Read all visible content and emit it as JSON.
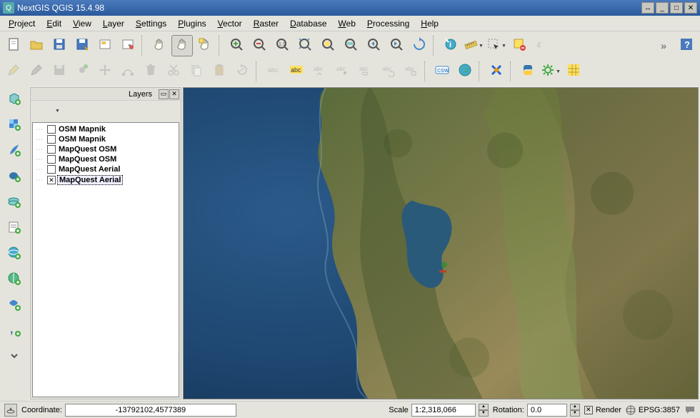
{
  "window": {
    "title": "NextGIS QGIS 15.4.98"
  },
  "menu": {
    "items": [
      "Project",
      "Edit",
      "View",
      "Layer",
      "Settings",
      "Plugins",
      "Vector",
      "Raster",
      "Database",
      "Web",
      "Processing",
      "Help"
    ]
  },
  "toolbar1": [
    {
      "name": "new-project",
      "icon": "doc"
    },
    {
      "name": "open-project",
      "icon": "folder"
    },
    {
      "name": "save-project",
      "icon": "save"
    },
    {
      "name": "save-as",
      "icon": "save-as"
    },
    {
      "name": "print-composer",
      "icon": "composer"
    },
    {
      "name": "composer-manager",
      "icon": "composer-mgr"
    },
    {
      "sep": true
    },
    {
      "name": "pan",
      "icon": "hand",
      "active": false
    },
    {
      "name": "pan-selection",
      "icon": "hand",
      "active": true
    },
    {
      "name": "zoom-in-tool",
      "icon": "zoom-plus-box"
    },
    {
      "sep": true
    },
    {
      "name": "zoom-in",
      "icon": "zoom-plus"
    },
    {
      "name": "zoom-out",
      "icon": "zoom-minus"
    },
    {
      "name": "zoom-1-1",
      "icon": "zoom-11"
    },
    {
      "name": "zoom-full",
      "icon": "zoom-full"
    },
    {
      "name": "zoom-selection",
      "icon": "zoom-sel"
    },
    {
      "name": "zoom-layer",
      "icon": "zoom-layer"
    },
    {
      "name": "zoom-last",
      "icon": "zoom-last"
    },
    {
      "name": "zoom-next",
      "icon": "zoom-next"
    },
    {
      "name": "refresh",
      "icon": "refresh"
    },
    {
      "sep": true
    },
    {
      "name": "identify",
      "icon": "identify"
    },
    {
      "name": "measure",
      "icon": "measure",
      "dd": true
    },
    {
      "name": "select",
      "icon": "select",
      "dd": true
    },
    {
      "name": "deselect",
      "icon": "deselect"
    },
    {
      "name": "expression",
      "icon": "expr",
      "disabled": true
    },
    {
      "overflow": true
    },
    {
      "name": "help",
      "icon": "help"
    }
  ],
  "toolbar2": [
    {
      "name": "toggle-edit",
      "icon": "pencil",
      "disabled": true
    },
    {
      "name": "edit-tool",
      "icon": "pencil2",
      "disabled": true
    },
    {
      "name": "save-edits",
      "icon": "save-layer",
      "disabled": true
    },
    {
      "name": "add-feature",
      "icon": "add-feature",
      "disabled": true
    },
    {
      "name": "move-feature",
      "icon": "move",
      "disabled": true
    },
    {
      "name": "node-tool",
      "icon": "node",
      "disabled": true
    },
    {
      "name": "delete-selected",
      "icon": "trash",
      "disabled": true
    },
    {
      "name": "cut",
      "icon": "cut",
      "disabled": true
    },
    {
      "name": "copy",
      "icon": "copy",
      "disabled": true
    },
    {
      "name": "paste",
      "icon": "paste",
      "disabled": true
    },
    {
      "name": "rotate",
      "icon": "rotate",
      "disabled": true
    },
    {
      "sep": true
    },
    {
      "name": "label-abc",
      "icon": "abc",
      "disabled": true
    },
    {
      "name": "label-hl",
      "icon": "abc-hl"
    },
    {
      "name": "label-move",
      "icon": "abc-move",
      "disabled": true
    },
    {
      "name": "label-pin",
      "icon": "abc-pin",
      "disabled": true
    },
    {
      "name": "label-show",
      "icon": "abc-show",
      "disabled": true
    },
    {
      "name": "label-rot",
      "icon": "abc-rot",
      "disabled": true
    },
    {
      "name": "label-prop",
      "icon": "abc-prop",
      "disabled": true
    },
    {
      "sep": true
    },
    {
      "name": "csw",
      "icon": "csw"
    },
    {
      "name": "web-globe",
      "icon": "globe"
    },
    {
      "sep": true
    },
    {
      "name": "crossing",
      "icon": "cross"
    },
    {
      "sep": true
    },
    {
      "name": "python",
      "icon": "python"
    },
    {
      "name": "plugins-cog",
      "icon": "cog",
      "dd": true
    },
    {
      "name": "grid",
      "icon": "grid"
    }
  ],
  "left_toolbar": [
    {
      "name": "add-vector",
      "icon": "v-poly"
    },
    {
      "name": "add-raster",
      "icon": "raster"
    },
    {
      "name": "add-spatialite",
      "icon": "feather"
    },
    {
      "name": "add-postgis",
      "icon": "elephant"
    },
    {
      "name": "add-wms",
      "icon": "wms"
    },
    {
      "name": "add-csv",
      "icon": "csv"
    },
    {
      "name": "add-wfs",
      "icon": "globe-wfs"
    },
    {
      "name": "add-wcs",
      "icon": "globe-wcs"
    },
    {
      "name": "add-virtual",
      "icon": "virtual"
    },
    {
      "name": "add-delimited",
      "icon": "comma"
    },
    {
      "name": "more-tools",
      "icon": "chev"
    }
  ],
  "layers_panel": {
    "title": "Layers",
    "toolbar": [
      {
        "name": "add-group",
        "icon": "group"
      },
      {
        "name": "visibility",
        "icon": "eye",
        "dd": true
      },
      {
        "name": "filter",
        "icon": "filter"
      },
      {
        "name": "expand",
        "icon": "expand"
      },
      {
        "name": "collapse",
        "icon": "collapse"
      },
      {
        "name": "remove",
        "icon": "remove"
      }
    ],
    "items": [
      {
        "name": "OSM Mapnik",
        "checked": false
      },
      {
        "name": "OSM Mapnik",
        "checked": false
      },
      {
        "name": "MapQuest OSM",
        "checked": false
      },
      {
        "name": "MapQuest OSM",
        "checked": false
      },
      {
        "name": "MapQuest Aerial",
        "checked": false
      },
      {
        "name": "MapQuest Aerial",
        "checked": true,
        "selected": true
      }
    ]
  },
  "statusbar": {
    "coord_label": "Coordinate:",
    "coord_value": "-13792102,4577389",
    "scale_label": "Scale",
    "scale_value": "1:2,318,066",
    "rotation_label": "Rotation:",
    "rotation_value": "0.0",
    "render_label": "Render",
    "render_checked": true,
    "crs": "EPSG:3857"
  }
}
